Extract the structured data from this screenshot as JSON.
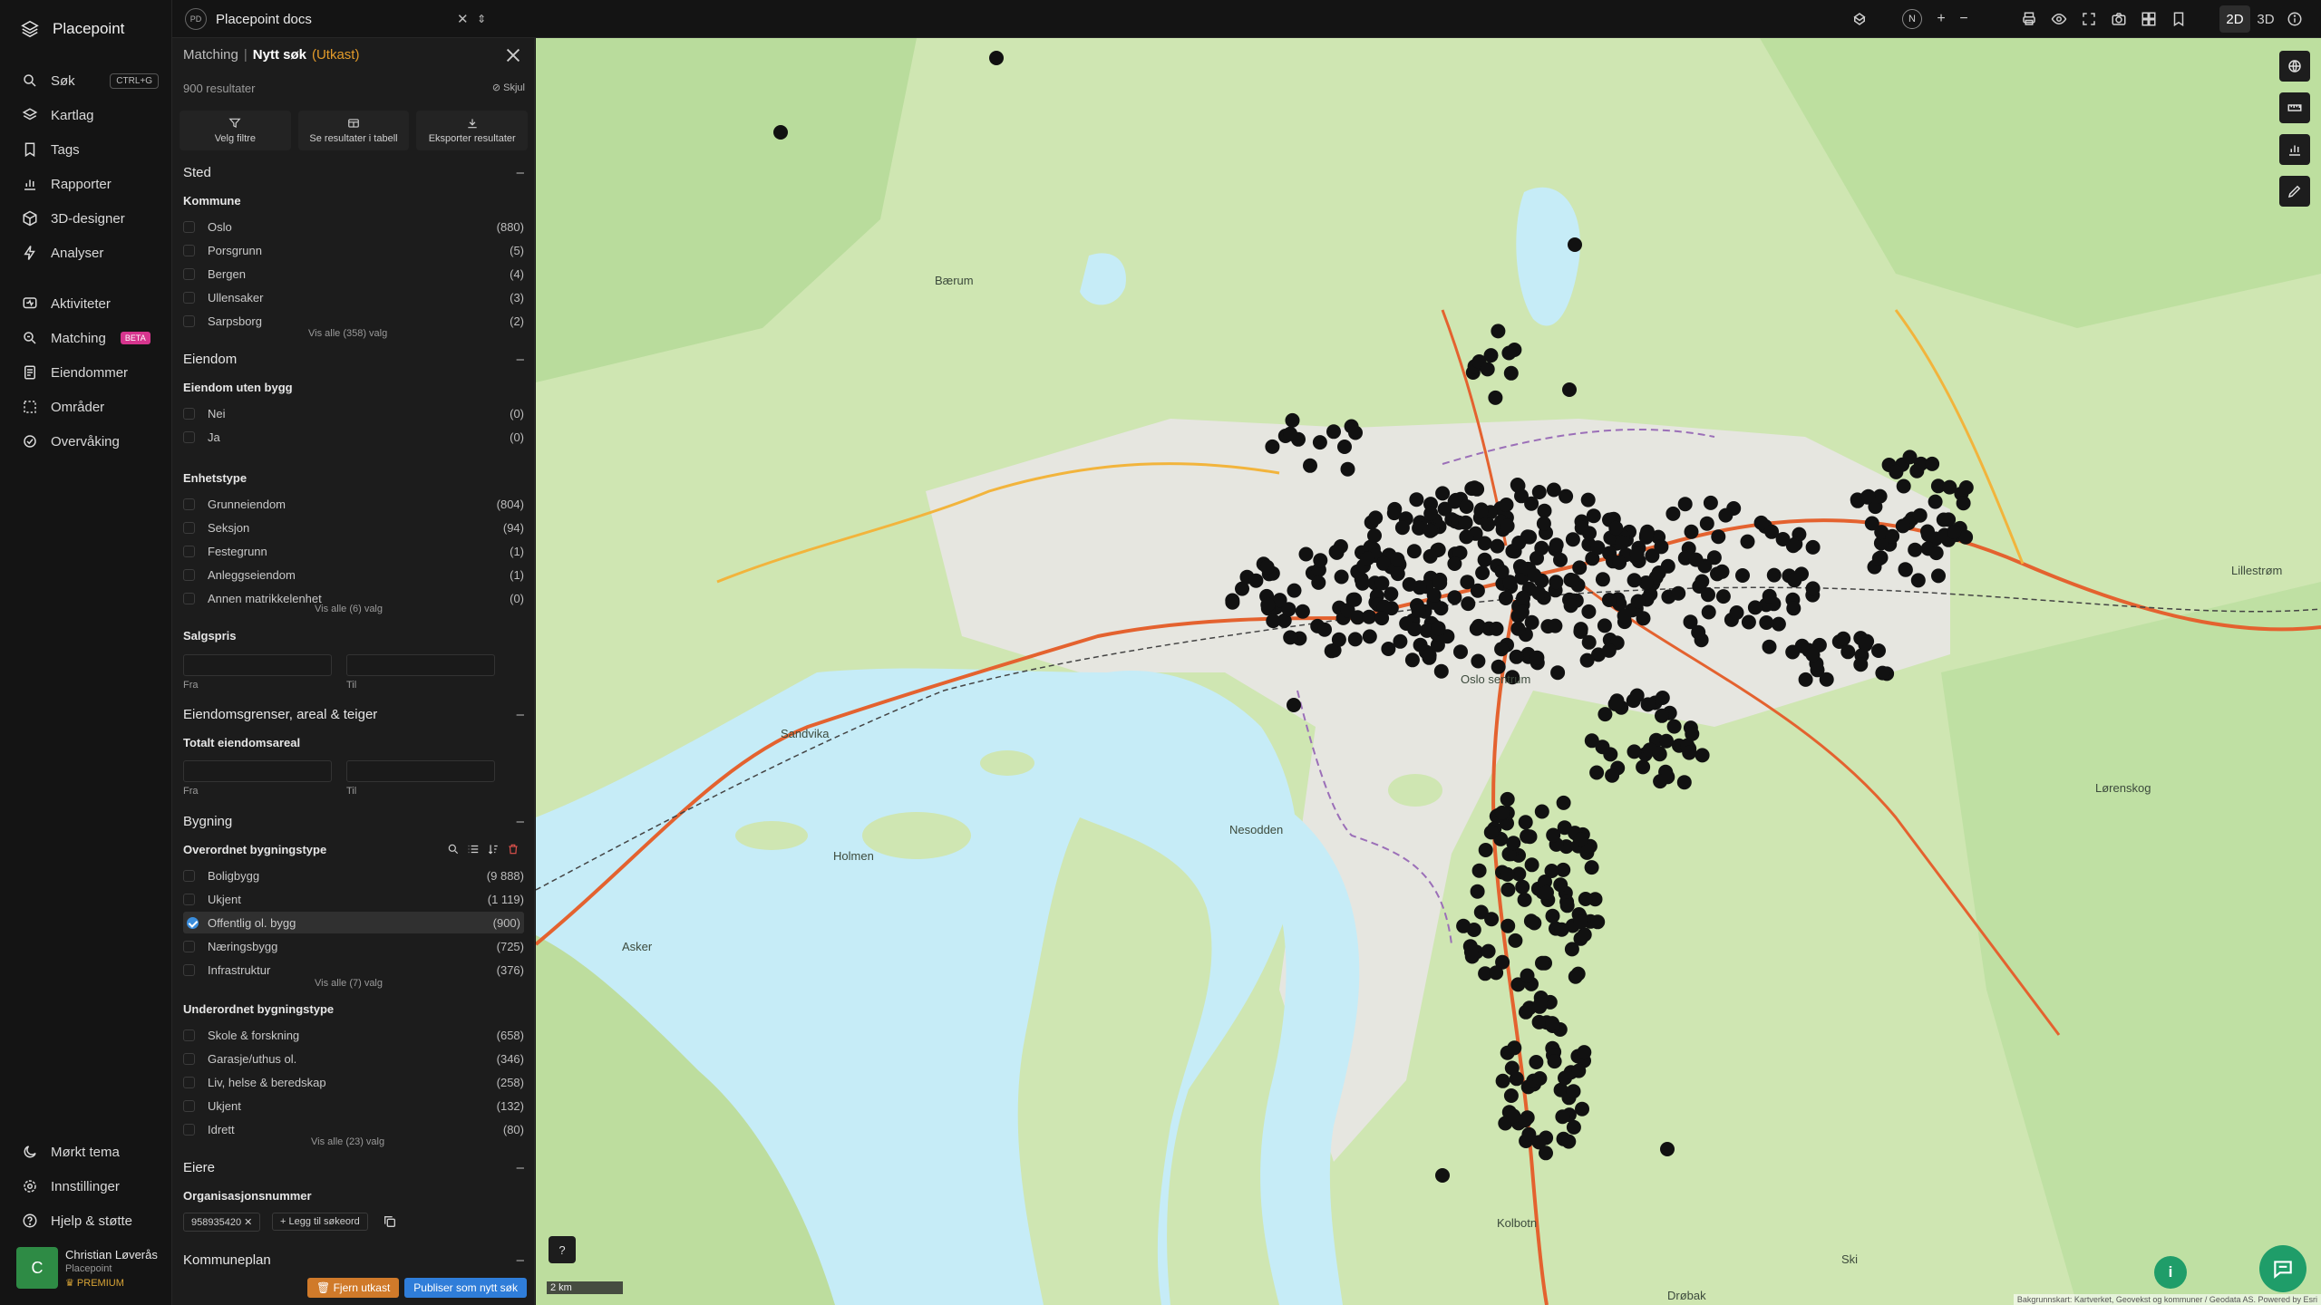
{
  "app": {
    "brand": "Placepoint",
    "document": {
      "badge": "PD",
      "name": "Placepoint docs"
    }
  },
  "nav": {
    "items": [
      {
        "label": "Søk",
        "kbd": "CTRL+G"
      },
      {
        "label": "Kartlag"
      },
      {
        "label": "Tags"
      },
      {
        "label": "Rapporter"
      },
      {
        "label": "3D-designer"
      },
      {
        "label": "Analyser"
      },
      {
        "label": "Aktiviteter"
      },
      {
        "label": "Matching",
        "badge": "BETA"
      },
      {
        "label": "Eiendommer"
      },
      {
        "label": "Områder"
      },
      {
        "label": "Overvåking"
      }
    ],
    "bottom": [
      {
        "label": "Mørkt tema"
      },
      {
        "label": "Innstillinger"
      },
      {
        "label": "Hjelp & støtte"
      }
    ],
    "user": {
      "initial": "C",
      "name": "Christian Løverås",
      "org": "Placepoint",
      "tier": "PREMIUM"
    }
  },
  "topbar": {
    "view_2d": "2D",
    "view_3d": "3D",
    "compass": "N"
  },
  "panel": {
    "crumb": "Matching",
    "title": "Nytt søk",
    "status": "(Utkast)",
    "results": "900 resultater",
    "hide": "Skjul",
    "actions": [
      "Velg filtre",
      "Se resultater i tabell",
      "Eksporter resultater"
    ],
    "sted": {
      "title": "Sted",
      "kommune": "Kommune",
      "options": [
        {
          "label": "Oslo",
          "count": "(880)"
        },
        {
          "label": "Porsgrunn",
          "count": "(5)"
        },
        {
          "label": "Bergen",
          "count": "(4)"
        },
        {
          "label": "Ullensaker",
          "count": "(3)"
        },
        {
          "label": "Sarpsborg",
          "count": "(2)"
        }
      ],
      "more": "Vis alle (358) valg"
    },
    "eiendom": {
      "title": "Eiendom",
      "uten_bygg": "Eiendom uten bygg",
      "uten_options": [
        {
          "label": "Nei",
          "count": "(0)"
        },
        {
          "label": "Ja",
          "count": "(0)"
        }
      ],
      "enhetstype": "Enhetstype",
      "enhet_options": [
        {
          "label": "Grunneiendom",
          "count": "(804)"
        },
        {
          "label": "Seksjon",
          "count": "(94)"
        },
        {
          "label": "Festegrunn",
          "count": "(1)"
        },
        {
          "label": "Anleggseiendom",
          "count": "(1)"
        },
        {
          "label": "Annen matrikkelenhet",
          "count": "(0)"
        }
      ],
      "enhet_more": "Vis alle (6) valg",
      "salgspris": "Salgspris",
      "from": "Fra",
      "to": "Til"
    },
    "grenser": {
      "title": "Eiendomsgrenser, areal & teiger",
      "totalt": "Totalt eiendomsareal",
      "from": "Fra",
      "to": "Til"
    },
    "bygning": {
      "title": "Bygning",
      "overordnet": "Overordnet bygningstype",
      "over_options": [
        {
          "label": "Boligbygg",
          "count": "(9 888)"
        },
        {
          "label": "Ukjent",
          "count": "(1 119)"
        },
        {
          "label": "Offentlig ol. bygg",
          "count": "(900)",
          "checked": true
        },
        {
          "label": "Næringsbygg",
          "count": "(725)"
        },
        {
          "label": "Infrastruktur",
          "count": "(376)"
        }
      ],
      "over_more": "Vis alle (7) valg",
      "underordnet": "Underordnet bygningstype",
      "under_options": [
        {
          "label": "Skole & forskning",
          "count": "(658)"
        },
        {
          "label": "Garasje/uthus ol.",
          "count": "(346)"
        },
        {
          "label": "Liv, helse & beredskap",
          "count": "(258)"
        },
        {
          "label": "Ukjent",
          "count": "(132)"
        },
        {
          "label": "Idrett",
          "count": "(80)"
        }
      ],
      "under_more": "Vis alle (23) valg"
    },
    "eiere": {
      "title": "Eiere",
      "orgnr_label": "Organisasjonsnummer",
      "orgnr_value": "958935420",
      "add_label": "Legg til søkeord"
    },
    "kommuneplan": {
      "title": "Kommuneplan"
    },
    "footer": {
      "remove": "Fjern utkast",
      "publish": "Publiser som nytt søk"
    }
  },
  "map": {
    "scale": "2 km",
    "help": "?",
    "info": "i",
    "attribution": "Bakgrunnskart: Kartverket, Geovekst og kommuner / Geodata AS. Powered by Esri",
    "places": [
      "Sandvika",
      "Asker",
      "Nesodden",
      "Lillestrøm",
      "Lørenskog",
      "Oslo sentrum",
      "Kolbotn",
      "Ski",
      "Bærum",
      "Holmen",
      "Drøbak"
    ],
    "colors": {
      "land": "#cfe6b2",
      "water": "#c6ecf7",
      "city": "#e6e6e0",
      "road": "#e4622f",
      "marker": "#111111"
    }
  }
}
